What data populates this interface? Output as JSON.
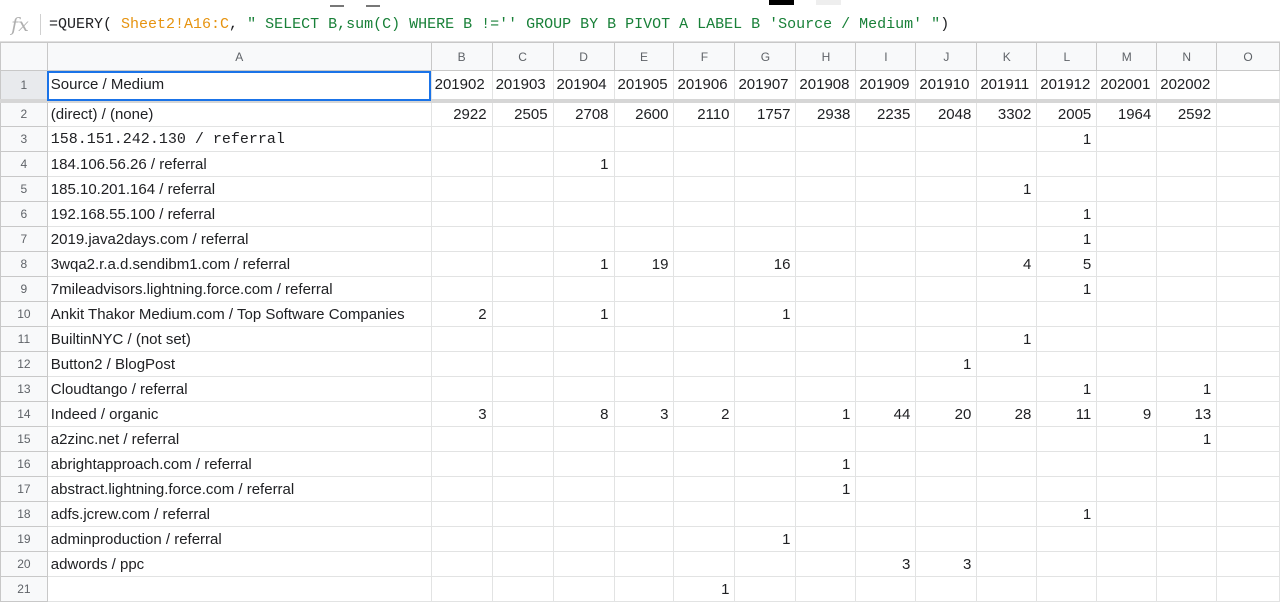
{
  "formula_bar": {
    "icon": "fx",
    "prefix": "=QUERY( ",
    "range_ref": "Sheet2!A16:C",
    "middle": ", ",
    "query_string": "\" SELECT B,sum(C) WHERE B !='' GROUP BY B PIVOT A LABEL B 'Source / Medium' \"",
    "suffix": ")"
  },
  "columns": [
    "A",
    "B",
    "C",
    "D",
    "E",
    "F",
    "G",
    "H",
    "I",
    "J",
    "K",
    "L",
    "M",
    "N",
    "O"
  ],
  "header_row": {
    "row_number": "1",
    "cells": [
      "Source / Medium",
      "201902",
      "201903",
      "201904",
      "201905",
      "201906",
      "201907",
      "201908",
      "201909",
      "201910",
      "201911",
      "201912",
      "202001",
      "202002",
      ""
    ]
  },
  "rows": [
    {
      "row_number": "2",
      "cells": [
        "(direct) / (none)",
        "2922",
        "2505",
        "2708",
        "2600",
        "2110",
        "1757",
        "2938",
        "2235",
        "2048",
        "3302",
        "2005",
        "1964",
        "2592",
        ""
      ]
    },
    {
      "row_number": "3",
      "cells": [
        "158.151.242.130 / referral",
        "",
        "",
        "",
        "",
        "",
        "",
        "",
        "",
        "",
        "",
        "1",
        "",
        "",
        ""
      ]
    },
    {
      "row_number": "4",
      "cells": [
        "184.106.56.26 / referral",
        "",
        "",
        "1",
        "",
        "",
        "",
        "",
        "",
        "",
        "",
        "",
        "",
        "",
        ""
      ]
    },
    {
      "row_number": "5",
      "cells": [
        "185.10.201.164 / referral",
        "",
        "",
        "",
        "",
        "",
        "",
        "",
        "",
        "",
        "1",
        "",
        "",
        "",
        ""
      ]
    },
    {
      "row_number": "6",
      "cells": [
        "192.168.55.100 / referral",
        "",
        "",
        "",
        "",
        "",
        "",
        "",
        "",
        "",
        "",
        "1",
        "",
        "",
        ""
      ]
    },
    {
      "row_number": "7",
      "cells": [
        "2019.java2days.com / referral",
        "",
        "",
        "",
        "",
        "",
        "",
        "",
        "",
        "",
        "",
        "1",
        "",
        "",
        ""
      ]
    },
    {
      "row_number": "8",
      "cells": [
        "3wqa2.r.a.d.sendibm1.com / referral",
        "",
        "",
        "1",
        "19",
        "",
        "16",
        "",
        "",
        "",
        "4",
        "5",
        "",
        "",
        ""
      ]
    },
    {
      "row_number": "9",
      "cells": [
        "7mileadvisors.lightning.force.com / referral",
        "",
        "",
        "",
        "",
        "",
        "",
        "",
        "",
        "",
        "",
        "1",
        "",
        "",
        ""
      ]
    },
    {
      "row_number": "10",
      "cells": [
        "Ankit Thakor Medium.com / Top Software Companies",
        "2",
        "",
        "1",
        "",
        "",
        "1",
        "",
        "",
        "",
        "",
        "",
        "",
        "",
        ""
      ]
    },
    {
      "row_number": "11",
      "cells": [
        "BuiltinNYC / (not set)",
        "",
        "",
        "",
        "",
        "",
        "",
        "",
        "",
        "",
        "1",
        "",
        "",
        "",
        ""
      ]
    },
    {
      "row_number": "12",
      "cells": [
        "Button2 / BlogPost",
        "",
        "",
        "",
        "",
        "",
        "",
        "",
        "",
        "1",
        "",
        "",
        "",
        "",
        ""
      ]
    },
    {
      "row_number": "13",
      "cells": [
        "Cloudtango / referral",
        "",
        "",
        "",
        "",
        "",
        "",
        "",
        "",
        "",
        "",
        "1",
        "",
        "1",
        ""
      ]
    },
    {
      "row_number": "14",
      "cells": [
        "Indeed / organic",
        "3",
        "",
        "8",
        "3",
        "2",
        "",
        "1",
        "44",
        "20",
        "28",
        "11",
        "9",
        "13",
        ""
      ]
    },
    {
      "row_number": "15",
      "cells": [
        "a2zinc.net / referral",
        "",
        "",
        "",
        "",
        "",
        "",
        "",
        "",
        "",
        "",
        "",
        "",
        "1",
        ""
      ]
    },
    {
      "row_number": "16",
      "cells": [
        "abrightapproach.com / referral",
        "",
        "",
        "",
        "",
        "",
        "",
        "1",
        "",
        "",
        "",
        "",
        "",
        "",
        ""
      ]
    },
    {
      "row_number": "17",
      "cells": [
        "abstract.lightning.force.com / referral",
        "",
        "",
        "",
        "",
        "",
        "",
        "1",
        "",
        "",
        "",
        "",
        "",
        "",
        ""
      ]
    },
    {
      "row_number": "18",
      "cells": [
        "adfs.jcrew.com / referral",
        "",
        "",
        "",
        "",
        "",
        "",
        "",
        "",
        "",
        "",
        "1",
        "",
        "",
        ""
      ]
    },
    {
      "row_number": "19",
      "cells": [
        "adminproduction / referral",
        "",
        "",
        "",
        "",
        "",
        "1",
        "",
        "",
        "",
        "",
        "",
        "",
        "",
        ""
      ]
    },
    {
      "row_number": "20",
      "cells": [
        "adwords / ppc",
        "",
        "",
        "",
        "",
        "",
        "",
        "",
        "3",
        "3",
        "",
        "",
        "",
        "",
        ""
      ]
    },
    {
      "row_number": "21",
      "cells": [
        "",
        "",
        "",
        "",
        "",
        "1",
        "",
        "",
        "",
        "",
        "",
        "",
        "",
        "",
        ""
      ]
    }
  ],
  "colors": {
    "selection": "#1a73e8",
    "header_bg": "#f8f9fa",
    "grid_line": "#e2e3e3",
    "formula_range": "#e6930f",
    "formula_string": "#188038"
  }
}
